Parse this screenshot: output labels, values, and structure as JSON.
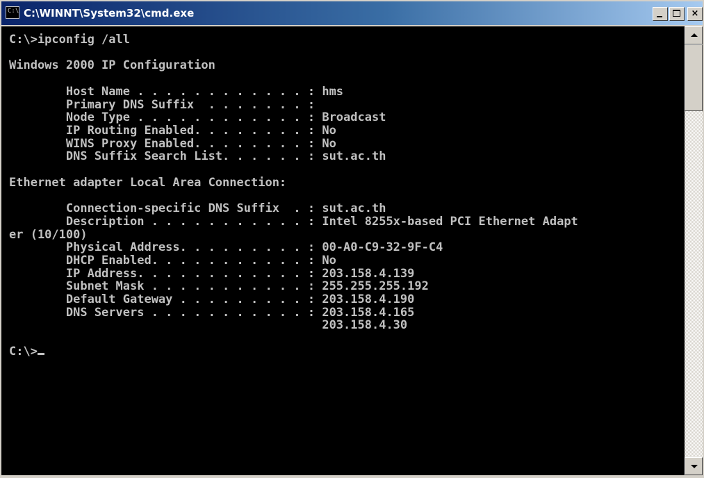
{
  "window": {
    "title": "C:\\WINNT\\System32\\cmd.exe",
    "icon_name": "cmd-console-icon",
    "icon_text": "C:\\",
    "buttons": {
      "minimize": "minimize-icon",
      "maximize": "maximize-icon",
      "close_label": "×"
    },
    "colors": {
      "title_start": "#0a246a",
      "title_end": "#a6caf0",
      "console_bg": "#000000",
      "console_text": "#c0c0c0"
    }
  },
  "console": {
    "lines": [
      "C:\\>ipconfig /all",
      "",
      "Windows 2000 IP Configuration",
      "",
      "        Host Name . . . . . . . . . . . . : hms",
      "        Primary DNS Suffix  . . . . . . . :",
      "        Node Type . . . . . . . . . . . . : Broadcast",
      "        IP Routing Enabled. . . . . . . . : No",
      "        WINS Proxy Enabled. . . . . . . . : No",
      "        DNS Suffix Search List. . . . . . : sut.ac.th",
      "",
      "Ethernet adapter Local Area Connection:",
      "",
      "        Connection-specific DNS Suffix  . : sut.ac.th",
      "        Description . . . . . . . . . . . : Intel 8255x-based PCI Ethernet Adapt",
      "er (10/100)",
      "        Physical Address. . . . . . . . . : 00-A0-C9-32-9F-C4",
      "        DHCP Enabled. . . . . . . . . . . : No",
      "        IP Address. . . . . . . . . . . . : 203.158.4.139",
      "        Subnet Mask . . . . . . . . . . . : 255.255.255.192",
      "        Default Gateway . . . . . . . . . : 203.158.4.190",
      "        DNS Servers . . . . . . . . . . . : 203.158.4.165",
      "                                            203.158.4.30",
      ""
    ],
    "prompt": "C:\\>"
  },
  "scrollbar": {
    "up_icon": "arrow-up-icon",
    "down_icon": "arrow-down-icon"
  }
}
